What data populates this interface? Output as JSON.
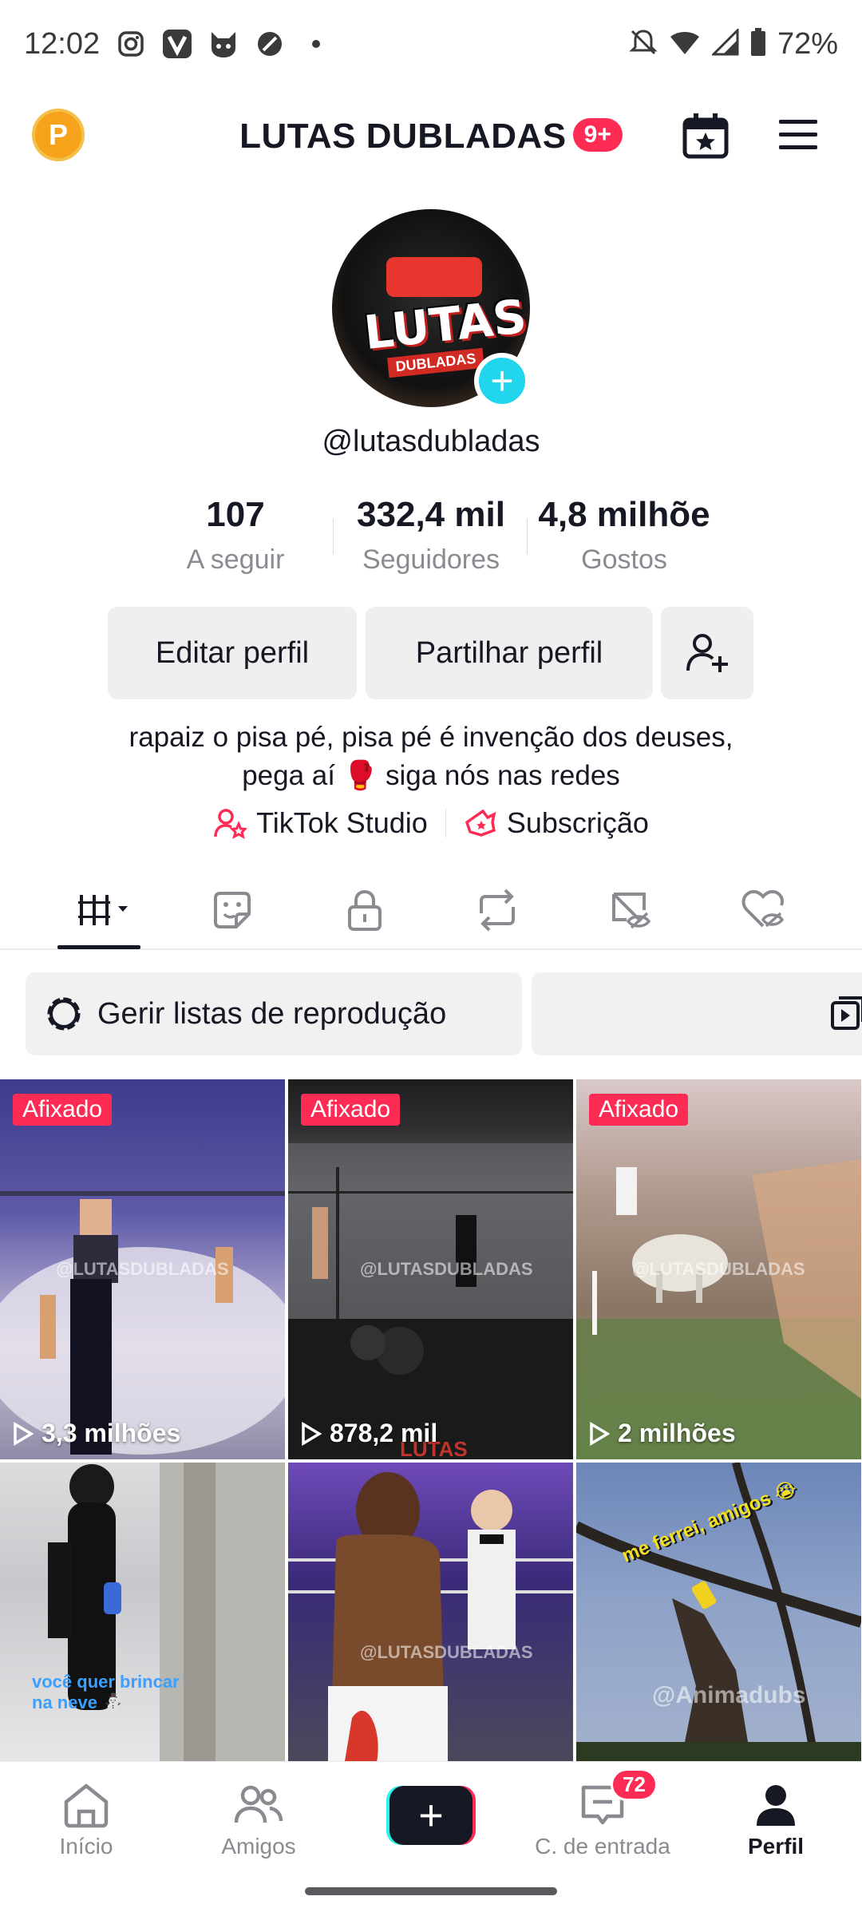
{
  "status_bar": {
    "time": "12:02",
    "battery": "72%",
    "icons": [
      "instagram-icon",
      "v-app-icon",
      "cat-app-icon",
      "no-sign-icon",
      "dot-icon",
      "mute-icon",
      "wifi-icon",
      "signal-icon",
      "battery-icon"
    ]
  },
  "header": {
    "coin_label": "P",
    "title": "LUTAS DUBLADAS",
    "notification_badge": "9+"
  },
  "profile": {
    "avatar_text": "LUTAS",
    "avatar_subtext": "DUBLADAS",
    "username": "@lutasdubladas",
    "stats": [
      {
        "value": "107",
        "label": "A seguir"
      },
      {
        "value": "332,4 mil",
        "label": "Seguidores"
      },
      {
        "value": "4,8 milhõe",
        "label": "Gostos"
      }
    ],
    "edit_button": "Editar perfil",
    "share_button": "Partilhar perfil",
    "bio_line1": "rapaiz o pisa pé, pisa pé é invenção dos deuses,",
    "bio_line2": "pega aí 🥊 siga nós nas redes",
    "links": [
      {
        "label": "TikTok Studio",
        "icon": "studio-icon"
      },
      {
        "label": "Subscrição",
        "icon": "subscription-icon"
      }
    ]
  },
  "tabs": [
    "videos-grid-icon",
    "stickers-icon",
    "private-lock-icon",
    "reposts-icon",
    "hidden-icon",
    "liked-hidden-icon"
  ],
  "playlist": {
    "manage_label": "Gerir listas de reprodução"
  },
  "videos": [
    {
      "pinned": "Afixado",
      "views": "3,3 milhões",
      "watermark": "@LUTASDUBLADAS"
    },
    {
      "pinned": "Afixado",
      "views": "878,2 mil",
      "watermark": "@LUTASDUBLADAS",
      "overlay": "LUTAS"
    },
    {
      "pinned": "Afixado",
      "views": "2 milhões",
      "watermark": "@LUTASDUBLADAS"
    },
    {
      "caption": "você quer brincar na neve ⛄"
    },
    {
      "watermark": "@LUTASDUBLADAS"
    },
    {
      "caption": "me ferrei, amigos 😭",
      "watermark": "@Animadubs"
    }
  ],
  "bottom_nav": {
    "home": "Início",
    "friends": "Amigos",
    "create": "+",
    "inbox": "C. de entrada",
    "inbox_badge": "72",
    "profile": "Perfil"
  },
  "colors": {
    "accent_red": "#fe2c55",
    "accent_cyan": "#25f4ee",
    "text_primary": "#161823",
    "text_secondary": "#8a8b91"
  }
}
